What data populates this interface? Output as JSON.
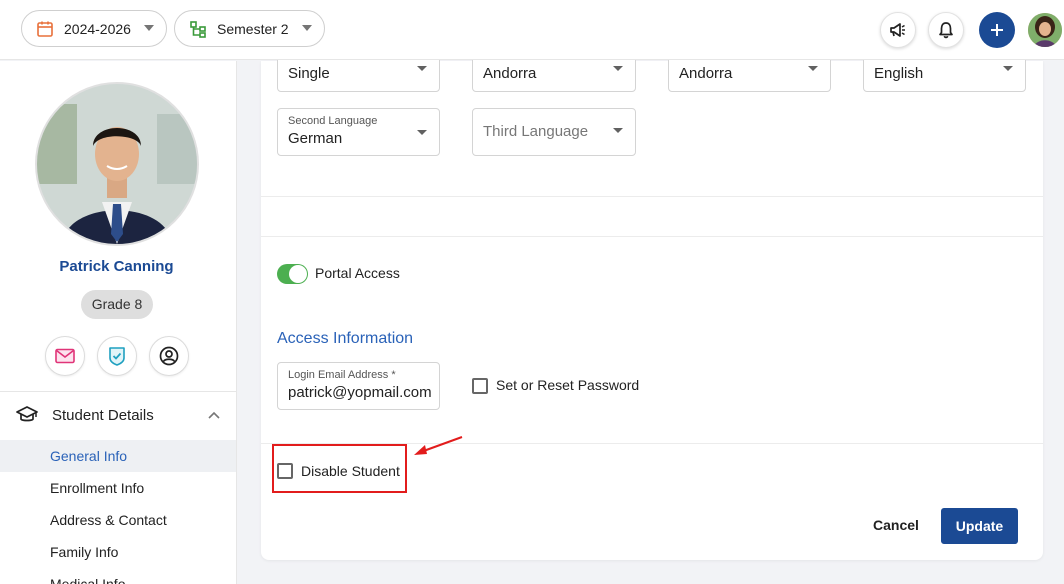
{
  "topbar": {
    "year_selector": "2024-2026",
    "semester_selector": "Semester 2",
    "icons": [
      "calendar-icon",
      "hierarchy-icon",
      "megaphone-icon",
      "bell-icon",
      "plus-icon"
    ]
  },
  "profile": {
    "name": "Patrick Canning",
    "grade": "Grade 8",
    "actions": [
      "mail-icon",
      "verified-shield-icon",
      "account-circle-icon"
    ]
  },
  "sidebar": {
    "section_title": "Student Details",
    "items": [
      {
        "label": "General Info",
        "active": true
      },
      {
        "label": "Enrollment Info",
        "active": false
      },
      {
        "label": "Address & Contact",
        "active": false
      },
      {
        "label": "Family Info",
        "active": false
      },
      {
        "label": "Medical Info",
        "active": false
      }
    ]
  },
  "form": {
    "row1": [
      {
        "value": "Single"
      },
      {
        "value": "Andorra"
      },
      {
        "value": "Andorra"
      },
      {
        "value": "English"
      }
    ],
    "second_language": {
      "label": "Second Language",
      "value": "German"
    },
    "third_language": {
      "placeholder": "Third Language"
    },
    "portal_access": {
      "label": "Portal Access",
      "enabled": true
    },
    "access_title": "Access Information",
    "login_email": {
      "label": "Login Email Address *",
      "value": "patrick@yopmail.com"
    },
    "reset_password": {
      "label": "Set or Reset Password",
      "checked": false
    },
    "disable_student": {
      "label": "Disable Student",
      "checked": false
    }
  },
  "buttons": {
    "cancel": "Cancel",
    "update": "Update"
  },
  "colors": {
    "primary": "#1b4a94",
    "link": "#2a62b8",
    "toggle_on": "#4caf50",
    "highlight": "#e21c1c"
  }
}
